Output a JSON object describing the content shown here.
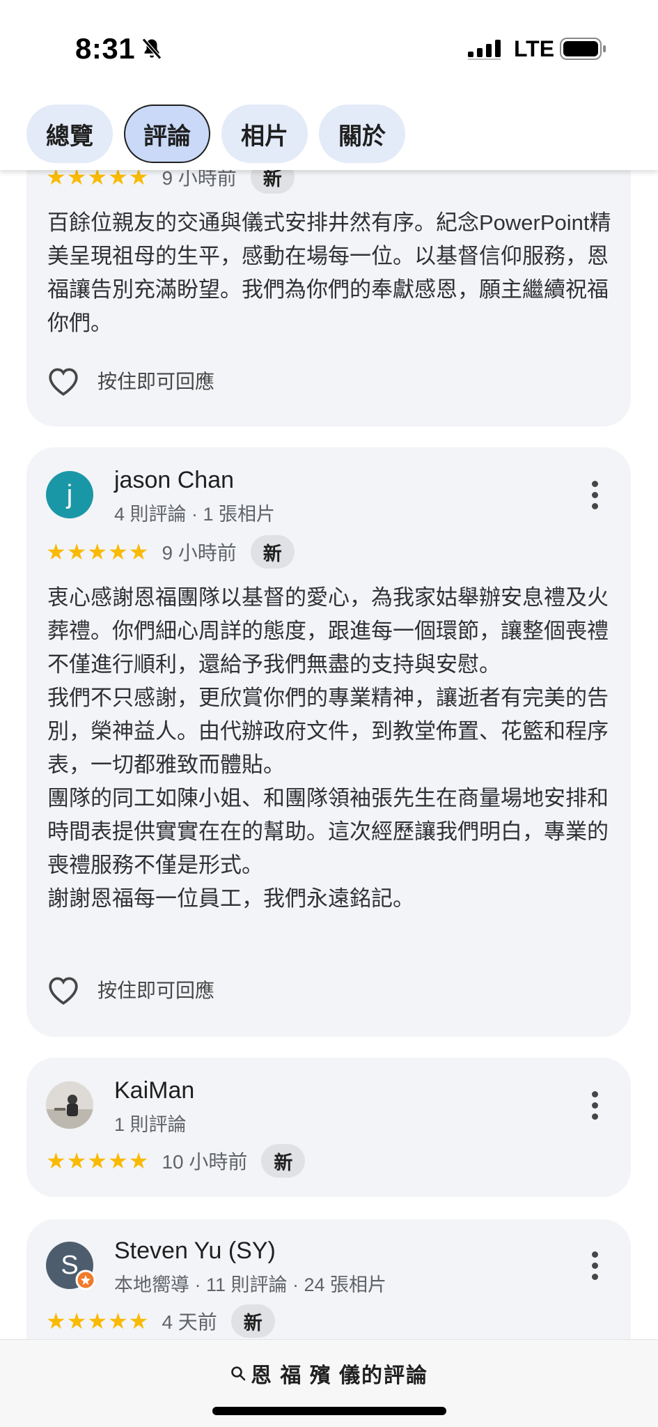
{
  "status": {
    "time": "8:31",
    "network": "LTE"
  },
  "tabs": [
    {
      "label": "總覽",
      "active": false
    },
    {
      "label": "評論",
      "active": true
    },
    {
      "label": "相片",
      "active": false
    },
    {
      "label": "關於",
      "active": false
    }
  ],
  "reviews": [
    {
      "rating": 5,
      "stars": "★★★★★",
      "time": "9 小時前",
      "badge": "新",
      "text": "百餘位親友的交通與儀式安排井然有序。紀念PowerPoint精美呈現祖母的生平，感動在場每一位。以基督信仰服務，恩福讓告別充滿盼望。我們為你們的奉獻感恩，願主繼續祝福你們。",
      "like_label": "按住即可回應"
    },
    {
      "name": "jason Chan",
      "avatar_letter": "j",
      "avatar_color": "#1a97a6",
      "meta": "4 則評論 · 1 張相片",
      "rating": 5,
      "stars": "★★★★★",
      "time": "9 小時前",
      "badge": "新",
      "text": "衷心感謝恩福團隊以基督的愛心，為我家姑舉辦安息禮及火葬禮。你們細心周詳的態度，跟進每一個環節，讓整個喪禮不僅進行順利，還給予我們無盡的支持與安慰。\n我們不只感謝，更欣賞你們的專業精神，讓逝者有完美的告別，榮神益人。由代辦政府文件，到教堂佈置、花籃和程序表，一切都雅致而體貼。\n團隊的同工如陳小姐、和團隊領袖張先生在商量場地安排和時間表提供實實在在的幫助。這次經歷讓我們明白，專業的喪禮服務不僅是形式。\n謝謝恩福每一位員工，我們永遠銘記。",
      "like_label": "按住即可回應"
    },
    {
      "name": "KaiMan",
      "meta": "1 則評論",
      "rating": 5,
      "stars": "★★★★★",
      "time": "10 小時前",
      "badge": "新"
    },
    {
      "name": "Steven Yu (SY)",
      "avatar_letter": "S",
      "avatar_color": "#4d5d6e",
      "meta": "本地嚮導 · 11 則評論 · 24 張相片",
      "rating": 5,
      "stars": "★★★★★",
      "time": "4 天前",
      "badge": "新"
    }
  ],
  "bottom": {
    "title": "恩 福 殯 儀的評論"
  },
  "colors": {
    "star": "#f9ba06",
    "tab_bg": "#e3eaf8",
    "tab_active_bg": "#c9d9f7",
    "card_bg": "#f3f4f7"
  }
}
